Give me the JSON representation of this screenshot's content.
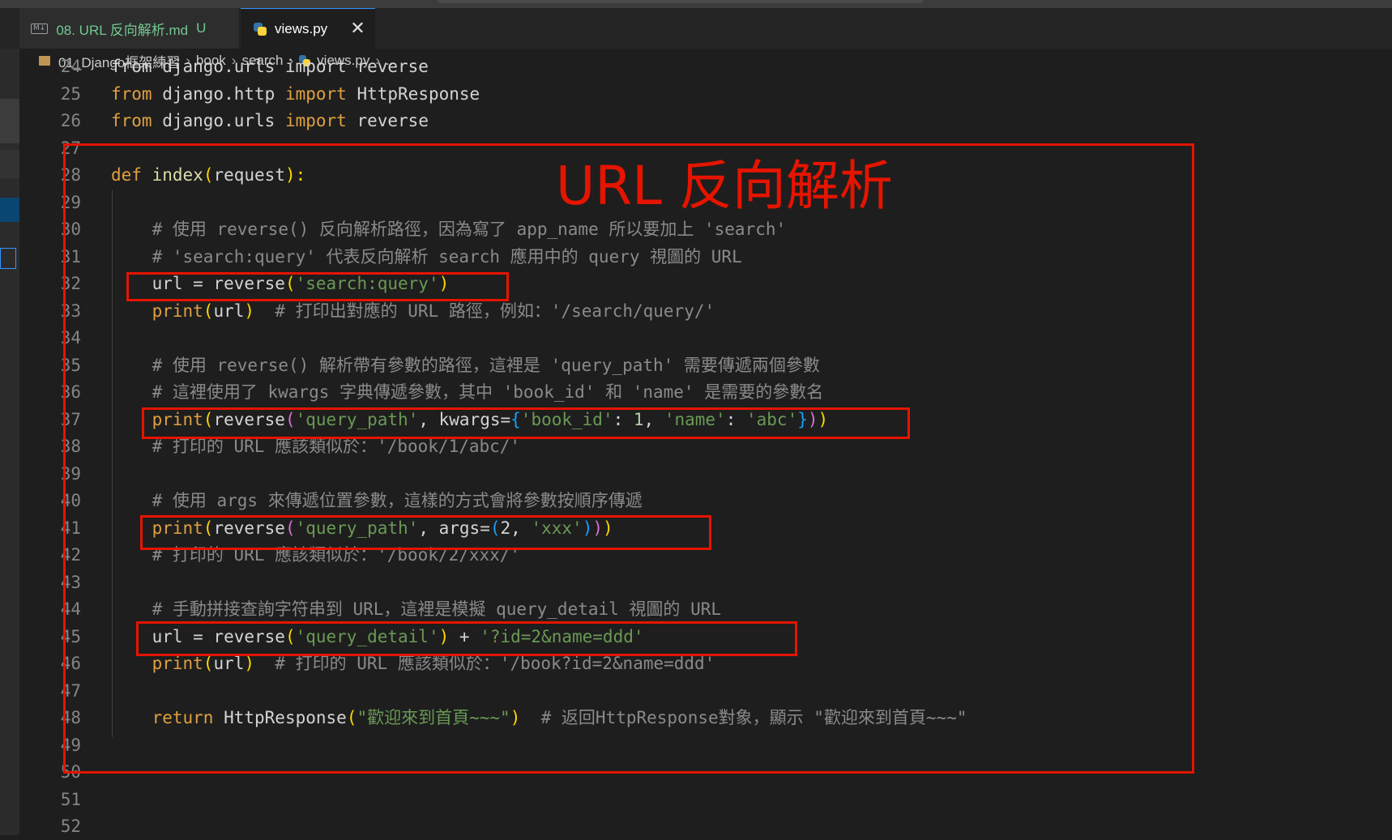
{
  "tabs": [
    {
      "icon": "markdown-icon",
      "badge": "M↓",
      "label": "08. URL 反向解析.md",
      "status": "U"
    },
    {
      "icon": "python-icon",
      "label": "views.py",
      "close": "✕"
    }
  ],
  "breadcrumb": [
    "01_Django框架練習",
    "book",
    "search",
    "views.py",
    "..."
  ],
  "breadcrumb_sep": "›",
  "annotation": "URL 反向解析",
  "line_numbers": [
    "24",
    "25",
    "26",
    "27",
    "28",
    "29",
    "30",
    "31",
    "32",
    "33",
    "34",
    "35",
    "36",
    "37",
    "38",
    "39",
    "40",
    "41",
    "42",
    "43",
    "44",
    "45",
    "46",
    "47",
    "48",
    "49",
    "50",
    "51",
    "52"
  ],
  "code_lines": [
    {
      "line": "24",
      "tokens": [
        {
          "t": "from django.urls import reverse",
          "c": "tx"
        }
      ]
    },
    {
      "line": "25",
      "tokens": [
        {
          "t": "from",
          "c": "kw2"
        },
        {
          "t": " django.http ",
          "c": "tx"
        },
        {
          "t": "import",
          "c": "kw2"
        },
        {
          "t": " HttpResponse",
          "c": "tx"
        }
      ]
    },
    {
      "line": "26",
      "tokens": [
        {
          "t": "from",
          "c": "kw2"
        },
        {
          "t": " django.urls ",
          "c": "tx"
        },
        {
          "t": "import",
          "c": "kw2"
        },
        {
          "t": " reverse",
          "c": "tx"
        }
      ]
    },
    {
      "line": "27",
      "tokens": []
    },
    {
      "line": "28",
      "tokens": [
        {
          "t": "def",
          "c": "kw2"
        },
        {
          "t": " ",
          "c": "tx"
        },
        {
          "t": "index",
          "c": "fn"
        },
        {
          "t": "(",
          "c": "p1"
        },
        {
          "t": "request",
          "c": "tx"
        },
        {
          "t": "):",
          "c": "p1"
        }
      ]
    },
    {
      "line": "29",
      "tokens": []
    },
    {
      "line": "30",
      "tokens": [
        {
          "t": "    # 使用 reverse() 反向解析路徑，因為寫了 app_name 所以要加上 'search'",
          "c": "cm2"
        }
      ]
    },
    {
      "line": "31",
      "tokens": [
        {
          "t": "    # 'search:query' 代表反向解析 search 應用中的 query 視圖的 URL",
          "c": "cm2"
        }
      ]
    },
    {
      "line": "32",
      "tokens": [
        {
          "t": "    url = reverse",
          "c": "tx"
        },
        {
          "t": "(",
          "c": "p1"
        },
        {
          "t": "'search:query'",
          "c": "st2"
        },
        {
          "t": ")",
          "c": "p1"
        }
      ]
    },
    {
      "line": "33",
      "tokens": [
        {
          "t": "    print",
          "c": "kw2"
        },
        {
          "t": "(",
          "c": "p1"
        },
        {
          "t": "url",
          "c": "tx"
        },
        {
          "t": ")",
          "c": "p1"
        },
        {
          "t": "  # 打印出對應的 URL 路徑，例如：'/search/query/'",
          "c": "cm2"
        }
      ]
    },
    {
      "line": "34",
      "tokens": []
    },
    {
      "line": "35",
      "tokens": [
        {
          "t": "    # 使用 reverse() 解析帶有參數的路徑，這裡是 'query_path' 需要傳遞兩個參數",
          "c": "cm2"
        }
      ]
    },
    {
      "line": "36",
      "tokens": [
        {
          "t": "    # 這裡使用了 kwargs 字典傳遞參數，其中 'book_id' 和 'name' 是需要的參數名",
          "c": "cm2"
        }
      ]
    },
    {
      "line": "37",
      "tokens": [
        {
          "t": "    print",
          "c": "kw2"
        },
        {
          "t": "(",
          "c": "p1"
        },
        {
          "t": "reverse",
          "c": "tx"
        },
        {
          "t": "(",
          "c": "p2"
        },
        {
          "t": "'query_path'",
          "c": "st2"
        },
        {
          "t": ", kwargs=",
          "c": "tx"
        },
        {
          "t": "{",
          "c": "p3"
        },
        {
          "t": "'book_id'",
          "c": "st2"
        },
        {
          "t": ": ",
          "c": "tx"
        },
        {
          "t": "1",
          "c": "nm"
        },
        {
          "t": ", ",
          "c": "tx"
        },
        {
          "t": "'name'",
          "c": "st2"
        },
        {
          "t": ": ",
          "c": "tx"
        },
        {
          "t": "'abc'",
          "c": "st2"
        },
        {
          "t": "}",
          "c": "p3"
        },
        {
          "t": ")",
          "c": "p2"
        },
        {
          "t": ")",
          "c": "p1"
        }
      ]
    },
    {
      "line": "38",
      "tokens": [
        {
          "t": "    # 打印的 URL 應該類似於：'/book/1/abc/'",
          "c": "cm2"
        }
      ]
    },
    {
      "line": "39",
      "tokens": []
    },
    {
      "line": "40",
      "tokens": [
        {
          "t": "    # 使用 args 來傳遞位置參數，這樣的方式會將參數按順序傳遞",
          "c": "cm2"
        }
      ]
    },
    {
      "line": "41",
      "tokens": [
        {
          "t": "    print",
          "c": "kw2"
        },
        {
          "t": "(",
          "c": "p1"
        },
        {
          "t": "reverse",
          "c": "tx"
        },
        {
          "t": "(",
          "c": "p2"
        },
        {
          "t": "'query_path'",
          "c": "st2"
        },
        {
          "t": ", args=",
          "c": "tx"
        },
        {
          "t": "(",
          "c": "p3"
        },
        {
          "t": "2",
          "c": "tx"
        },
        {
          "t": ", ",
          "c": "tx"
        },
        {
          "t": "'xxx'",
          "c": "st2"
        },
        {
          "t": ")",
          "c": "p3"
        },
        {
          "t": ")",
          "c": "p2"
        },
        {
          "t": ")",
          "c": "p1"
        }
      ]
    },
    {
      "line": "42",
      "tokens": [
        {
          "t": "    # 打印的 URL 應該類似於：'/book/2/xxx/'",
          "c": "cm2"
        }
      ]
    },
    {
      "line": "43",
      "tokens": []
    },
    {
      "line": "44",
      "tokens": [
        {
          "t": "    # 手動拼接查詢字符串到 URL，這裡是模擬 query_detail 視圖的 URL",
          "c": "cm2"
        }
      ]
    },
    {
      "line": "45",
      "tokens": [
        {
          "t": "    url = reverse",
          "c": "tx"
        },
        {
          "t": "(",
          "c": "p1"
        },
        {
          "t": "'query_detail'",
          "c": "st2"
        },
        {
          "t": ")",
          "c": "p1"
        },
        {
          "t": " + ",
          "c": "tx"
        },
        {
          "t": "'?id=2&name=ddd'",
          "c": "st2"
        }
      ]
    },
    {
      "line": "46",
      "tokens": [
        {
          "t": "    print",
          "c": "kw2"
        },
        {
          "t": "(",
          "c": "p1"
        },
        {
          "t": "url",
          "c": "tx"
        },
        {
          "t": ")",
          "c": "p1"
        },
        {
          "t": "  # 打印的 URL 應該類似於：'/book?id=2&name=ddd'",
          "c": "cm2"
        }
      ]
    },
    {
      "line": "47",
      "tokens": []
    },
    {
      "line": "48",
      "tokens": [
        {
          "t": "    return",
          "c": "kw2"
        },
        {
          "t": " HttpResponse",
          "c": "tx"
        },
        {
          "t": "(",
          "c": "p1"
        },
        {
          "t": "\"歡迎來到首頁~~~\"",
          "c": "st2"
        },
        {
          "t": ")",
          "c": "p1"
        },
        {
          "t": "  # 返回HttpResponse對象，顯示 \"歡迎來到首頁~~~\"",
          "c": "cm2"
        }
      ]
    },
    {
      "line": "49",
      "tokens": []
    },
    {
      "line": "50",
      "tokens": []
    },
    {
      "line": "51",
      "tokens": []
    },
    {
      "line": "52",
      "tokens": []
    }
  ]
}
